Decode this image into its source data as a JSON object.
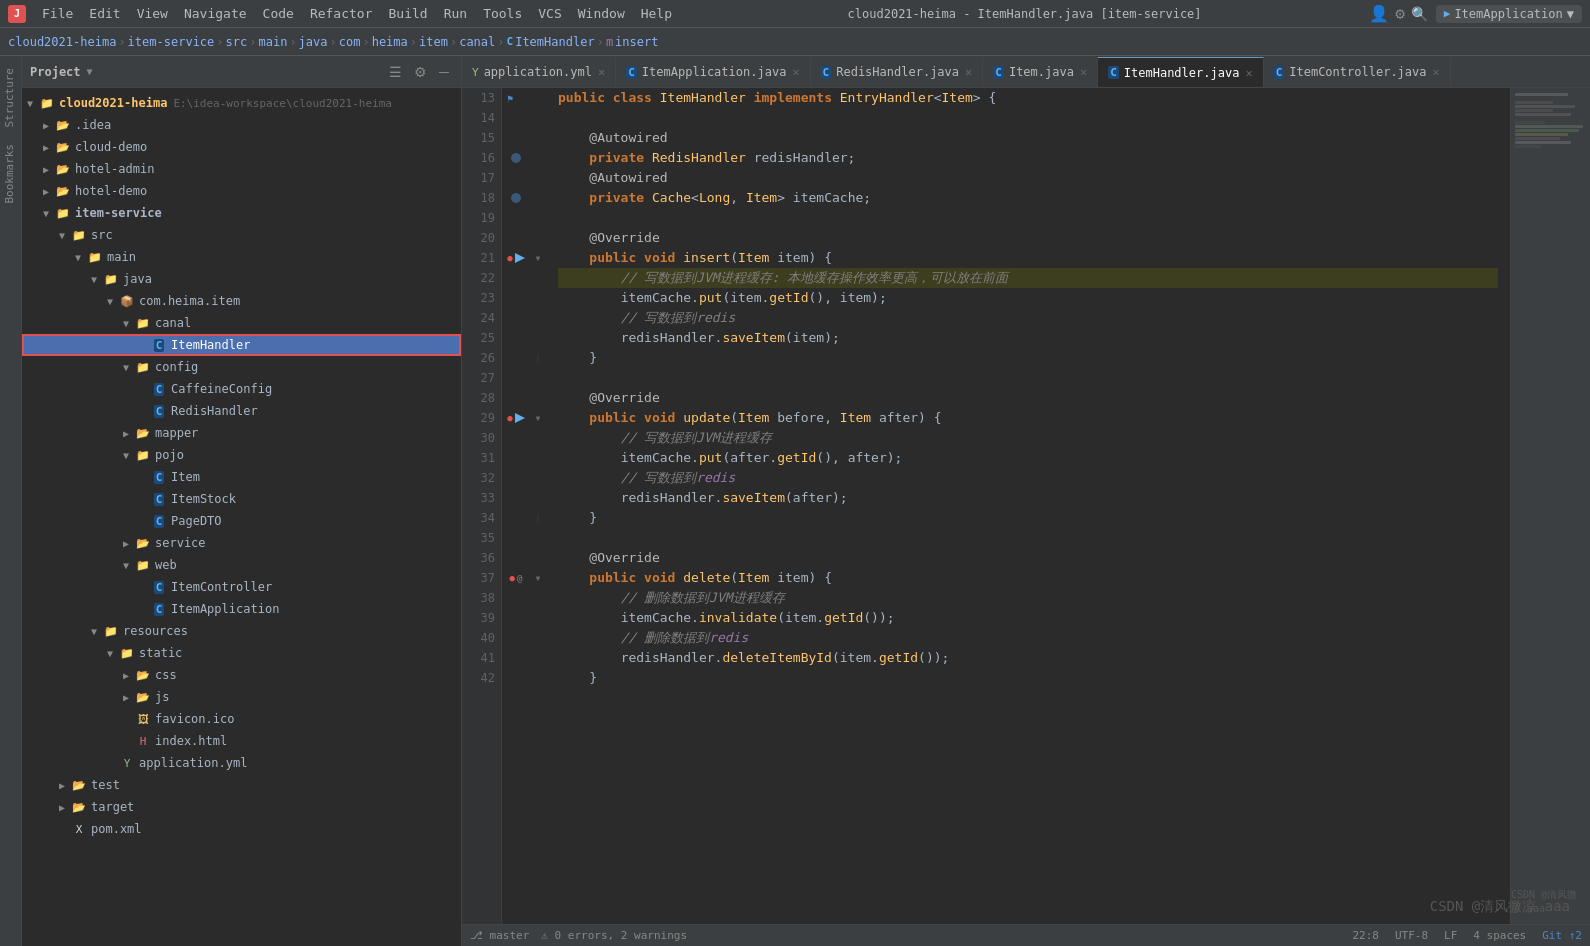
{
  "window": {
    "title": "cloud2021-heima - ItemHandler.java [item-service]"
  },
  "menubar": {
    "items": [
      "File",
      "Edit",
      "View",
      "Navigate",
      "Code",
      "Refactor",
      "Build",
      "Run",
      "Tools",
      "VCS",
      "Window",
      "Help"
    ]
  },
  "breadcrumb": {
    "items": [
      "cloud2021-heima",
      "item-service",
      "src",
      "main",
      "java",
      "com",
      "heima",
      "item",
      "canal",
      "ItemHandler",
      "insert"
    ]
  },
  "sidebar": {
    "title": "Project",
    "tree": [
      {
        "id": "cloud2021-heima",
        "label": "cloud2021-heima",
        "type": "root",
        "indent": 0,
        "expanded": true,
        "path": "E:\\idea-workspace\\cloud2021-heima"
      },
      {
        "id": "idea",
        "label": ".idea",
        "type": "folder",
        "indent": 1,
        "expanded": false
      },
      {
        "id": "cloud-demo",
        "label": "cloud-demo",
        "type": "module",
        "indent": 1,
        "expanded": false
      },
      {
        "id": "hotel-admin",
        "label": "hotel-admin",
        "type": "module",
        "indent": 1,
        "expanded": false
      },
      {
        "id": "hotel-demo",
        "label": "hotel-demo",
        "type": "module",
        "indent": 1,
        "expanded": false
      },
      {
        "id": "item-service",
        "label": "item-service",
        "type": "module",
        "indent": 1,
        "expanded": true
      },
      {
        "id": "src",
        "label": "src",
        "type": "folder",
        "indent": 2,
        "expanded": true
      },
      {
        "id": "main",
        "label": "main",
        "type": "folder",
        "indent": 3,
        "expanded": true
      },
      {
        "id": "java",
        "label": "java",
        "type": "folder",
        "indent": 4,
        "expanded": true
      },
      {
        "id": "com.heima.item",
        "label": "com.heima.item",
        "type": "package",
        "indent": 5,
        "expanded": true
      },
      {
        "id": "canal",
        "label": "canal",
        "type": "folder",
        "indent": 6,
        "expanded": true
      },
      {
        "id": "ItemHandler",
        "label": "ItemHandler",
        "type": "java-class",
        "indent": 7,
        "expanded": false,
        "selected": true
      },
      {
        "id": "config",
        "label": "config",
        "type": "folder",
        "indent": 6,
        "expanded": true
      },
      {
        "id": "CaffeineConfig",
        "label": "CaffeineConfig",
        "type": "java-class",
        "indent": 7,
        "expanded": false
      },
      {
        "id": "RedisHandler",
        "label": "RedisHandler",
        "type": "java-class",
        "indent": 7,
        "expanded": false
      },
      {
        "id": "mapper",
        "label": "mapper",
        "type": "folder",
        "indent": 6,
        "expanded": false
      },
      {
        "id": "pojo",
        "label": "pojo",
        "type": "folder",
        "indent": 6,
        "expanded": true
      },
      {
        "id": "Item",
        "label": "Item",
        "type": "java-class",
        "indent": 7,
        "expanded": false
      },
      {
        "id": "ItemStock",
        "label": "ItemStock",
        "type": "java-class",
        "indent": 7,
        "expanded": false
      },
      {
        "id": "PageDTO",
        "label": "PageDTO",
        "type": "java-class",
        "indent": 7,
        "expanded": false
      },
      {
        "id": "service",
        "label": "service",
        "type": "folder",
        "indent": 6,
        "expanded": false
      },
      {
        "id": "web",
        "label": "web",
        "type": "folder",
        "indent": 6,
        "expanded": true
      },
      {
        "id": "ItemController",
        "label": "ItemController",
        "type": "java-class",
        "indent": 7,
        "expanded": false
      },
      {
        "id": "ItemApplication",
        "label": "ItemApplication",
        "type": "java-class",
        "indent": 7,
        "expanded": false
      },
      {
        "id": "resources",
        "label": "resources",
        "type": "folder",
        "indent": 4,
        "expanded": true
      },
      {
        "id": "static",
        "label": "static",
        "type": "folder",
        "indent": 5,
        "expanded": true
      },
      {
        "id": "css",
        "label": "css",
        "type": "folder",
        "indent": 6,
        "expanded": false
      },
      {
        "id": "js",
        "label": "js",
        "type": "folder",
        "indent": 6,
        "expanded": false
      },
      {
        "id": "favicon.ico",
        "label": "favicon.ico",
        "type": "file",
        "indent": 6
      },
      {
        "id": "index.html",
        "label": "index.html",
        "type": "html",
        "indent": 6
      },
      {
        "id": "application.yml",
        "label": "application.yml",
        "type": "yaml",
        "indent": 5
      },
      {
        "id": "test",
        "label": "test",
        "type": "folder",
        "indent": 2,
        "expanded": false
      },
      {
        "id": "target",
        "label": "target",
        "type": "folder",
        "indent": 2,
        "expanded": false
      },
      {
        "id": "pom.xml",
        "label": "pom.xml",
        "type": "xml",
        "indent": 2
      }
    ]
  },
  "tabs": [
    {
      "id": "application.yml",
      "label": "application.yml",
      "type": "yaml",
      "active": false
    },
    {
      "id": "ItemApplication",
      "label": "ItemApplication.java",
      "type": "java",
      "active": false
    },
    {
      "id": "RedisHandler",
      "label": "RedisHandler.java",
      "type": "java",
      "active": false
    },
    {
      "id": "Item",
      "label": "Item.java",
      "type": "java",
      "active": false
    },
    {
      "id": "ItemHandler",
      "label": "ItemHandler.java",
      "type": "java",
      "active": true
    },
    {
      "id": "ItemController",
      "label": "ItemController.java",
      "type": "java",
      "active": false
    }
  ],
  "code": {
    "lines": [
      {
        "num": 13,
        "content": "public class ItemHandler implements EntryHandler<Item> {",
        "gutter": ""
      },
      {
        "num": 14,
        "content": "",
        "gutter": ""
      },
      {
        "num": 15,
        "content": "    @Autowired",
        "gutter": ""
      },
      {
        "num": 16,
        "content": "    private RedisHandler redisHandler;",
        "gutter": "bean"
      },
      {
        "num": 17,
        "content": "    @Autowired",
        "gutter": ""
      },
      {
        "num": 18,
        "content": "    private Cache<Long, Item> itemCache;",
        "gutter": "bean"
      },
      {
        "num": 19,
        "content": "",
        "gutter": ""
      },
      {
        "num": 20,
        "content": "    @Override",
        "gutter": ""
      },
      {
        "num": 21,
        "content": "    public void insert(Item item) {",
        "gutter": ""
      },
      {
        "num": 22,
        "content": "        // 写数据到JVM进程缓存: 本地缓存操作效率更高，可以放在前面",
        "gutter": "",
        "highlighted": true
      },
      {
        "num": 23,
        "content": "        itemCache.put(item.getId(), item);",
        "gutter": ""
      },
      {
        "num": 24,
        "content": "        // 写数据到redis",
        "gutter": ""
      },
      {
        "num": 25,
        "content": "        redisHandler.saveItem(item);",
        "gutter": ""
      },
      {
        "num": 26,
        "content": "    }",
        "gutter": ""
      },
      {
        "num": 27,
        "content": "",
        "gutter": ""
      },
      {
        "num": 28,
        "content": "    @Override",
        "gutter": ""
      },
      {
        "num": 29,
        "content": "    public void update(Item before, Item after) {",
        "gutter": ""
      },
      {
        "num": 30,
        "content": "        // 写数据到JVM进程缓存",
        "gutter": ""
      },
      {
        "num": 31,
        "content": "        itemCache.put(after.getId(), after);",
        "gutter": ""
      },
      {
        "num": 32,
        "content": "        // 写数据到redis",
        "gutter": ""
      },
      {
        "num": 33,
        "content": "        redisHandler.saveItem(after);",
        "gutter": ""
      },
      {
        "num": 34,
        "content": "    }",
        "gutter": ""
      },
      {
        "num": 35,
        "content": "",
        "gutter": ""
      },
      {
        "num": 36,
        "content": "    @Override",
        "gutter": ""
      },
      {
        "num": 37,
        "content": "    public void delete(Item item) {",
        "gutter": ""
      },
      {
        "num": 38,
        "content": "        // 删除数据到JVM进程缓存",
        "gutter": ""
      },
      {
        "num": 39,
        "content": "        itemCache.invalidate(item.getId());",
        "gutter": ""
      },
      {
        "num": 40,
        "content": "        // 删除数据到redis",
        "gutter": ""
      },
      {
        "num": 41,
        "content": "        redisHandler.deleteItemById(item.getId());",
        "gutter": ""
      },
      {
        "num": 42,
        "content": "    }",
        "gutter": ""
      }
    ]
  },
  "watermark": "CSDN @清风微凉 aaa",
  "run_config": "ItemApplication"
}
